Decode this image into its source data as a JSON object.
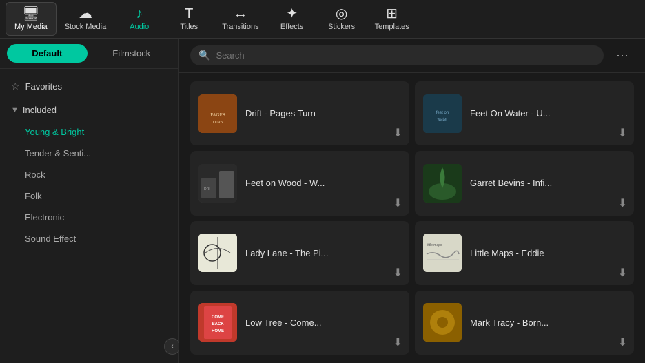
{
  "nav": {
    "items": [
      {
        "id": "my-media",
        "label": "My Media",
        "icon": "🖥",
        "active": true
      },
      {
        "id": "stock-media",
        "label": "Stock Media",
        "icon": "☁",
        "active": false
      },
      {
        "id": "audio",
        "label": "Audio",
        "icon": "♪",
        "active": false
      },
      {
        "id": "titles",
        "label": "Titles",
        "icon": "T",
        "active": false
      },
      {
        "id": "transitions",
        "label": "Transitions",
        "icon": "↔",
        "active": false
      },
      {
        "id": "effects",
        "label": "Effects",
        "icon": "✦",
        "active": false
      },
      {
        "id": "stickers",
        "label": "Stickers",
        "icon": "◉",
        "active": false
      },
      {
        "id": "templates",
        "label": "Templates",
        "icon": "⊞",
        "active": false
      }
    ]
  },
  "sidebar": {
    "tabs": [
      {
        "id": "default",
        "label": "Default",
        "active": true
      },
      {
        "id": "filmstock",
        "label": "Filmstock",
        "active": false
      }
    ],
    "favorites_label": "Favorites",
    "included_label": "Included",
    "sub_items": [
      {
        "id": "young-bright",
        "label": "Young & Bright",
        "active": true
      },
      {
        "id": "tender",
        "label": "Tender & Senti...",
        "active": false
      },
      {
        "id": "rock",
        "label": "Rock",
        "active": false
      },
      {
        "id": "folk",
        "label": "Folk",
        "active": false
      },
      {
        "id": "electronic",
        "label": "Electronic",
        "active": false
      },
      {
        "id": "sound-effect",
        "label": "Sound Effect",
        "active": false
      }
    ]
  },
  "search": {
    "placeholder": "Search"
  },
  "music_cards": [
    {
      "id": "drift",
      "title": "Drift - Pages Turn",
      "thumb_class": "thumb-drift"
    },
    {
      "id": "feet-water",
      "title": "Feet On Water - U...",
      "thumb_class": "thumb-feet-water"
    },
    {
      "id": "feet-wood",
      "title": "Feet on Wood - W...",
      "thumb_class": "thumb-feet-wood"
    },
    {
      "id": "garret",
      "title": "Garret Bevins - Infi...",
      "thumb_class": "thumb-garret"
    },
    {
      "id": "lady",
      "title": "Lady Lane - The Pi...",
      "thumb_class": "thumb-lady"
    },
    {
      "id": "little",
      "title": "Little Maps - Eddie",
      "thumb_class": "thumb-little"
    },
    {
      "id": "low-tree",
      "title": "Low Tree - Come...",
      "thumb_class": "thumb-low"
    },
    {
      "id": "mark",
      "title": "Mark Tracy - Born...",
      "thumb_class": "thumb-mark"
    }
  ]
}
